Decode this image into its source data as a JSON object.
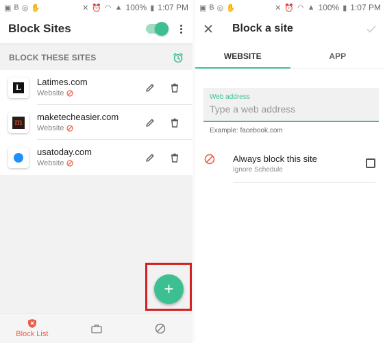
{
  "status": {
    "battery": "100%",
    "time": "1:07 PM"
  },
  "left": {
    "title": "Block Sites",
    "section_label": "BLOCK THESE SITES",
    "sites": [
      {
        "name": "Latimes.com",
        "type": "Website",
        "favicon_text": "L"
      },
      {
        "name": "maketecheasier.com",
        "type": "Website",
        "favicon_text": "m"
      },
      {
        "name": "usatoday.com",
        "type": "Website",
        "favicon_text": ""
      }
    ],
    "fab_label": "+",
    "nav": {
      "block_list": "Block List"
    },
    "toggle_on": true
  },
  "right": {
    "title": "Block a site",
    "tabs": [
      "WEBSITE",
      "APP"
    ],
    "active_tab": "WEBSITE",
    "field_label": "Web address",
    "field_placeholder": "Type a web address",
    "field_value": "",
    "hint": "Example: facebook.com",
    "always_title": "Always block this site",
    "always_sub": "Ignore Schedule",
    "always_checked": false
  },
  "colors": {
    "accent": "#3cbf91",
    "block_red": "#e8604a",
    "highlight": "#d21f1f"
  }
}
